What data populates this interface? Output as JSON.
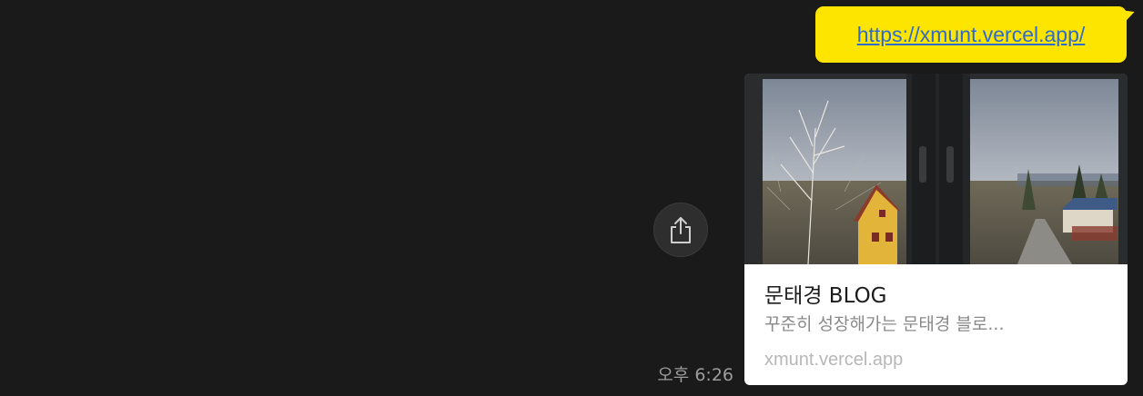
{
  "message": {
    "url": "https://xmunt.vercel.app/",
    "timestamp": "오후 6:26",
    "bubble_color": "#fee500",
    "link_color": "#2f6bcf"
  },
  "link_preview": {
    "title": "문태경 BLOG",
    "description": "꾸준히 성장해가는 문태경 블로...",
    "domain": "xmunt.vercel.app",
    "thumbnail_icon": "window-view-photo"
  },
  "share_button": {
    "icon": "share-icon"
  }
}
